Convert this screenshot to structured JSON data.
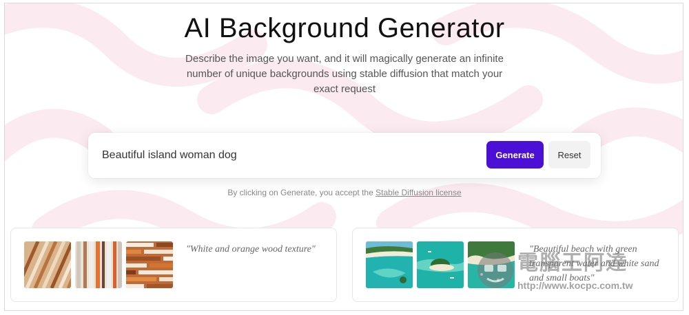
{
  "hero": {
    "title": "AI Background Generator",
    "subtitle": "Describe the image you want, and it will magically generate an infinite number of unique backgrounds using stable diffusion that match your exact request"
  },
  "search": {
    "value": "Beautiful island woman dog",
    "generate_label": "Generate",
    "reset_label": "Reset"
  },
  "license": {
    "prefix": "By clicking on Generate, you accept the ",
    "link_text": "Stable Diffusion license"
  },
  "examples": [
    {
      "caption": "\"White and orange wood texture\"",
      "thumbs": [
        "wood-texture-1",
        "wood-texture-2",
        "wood-texture-3"
      ]
    },
    {
      "caption": "\"Beautiful beach with green transparent water and white sand and small boats\"",
      "thumbs": [
        "beach-1",
        "beach-2",
        "beach-3"
      ]
    }
  ],
  "watermark": {
    "text": "電腦王阿達",
    "url": "http://www.kocpc.com.tw"
  },
  "colors": {
    "accent": "#4b0fd6",
    "pattern": "#fbe9f0"
  }
}
